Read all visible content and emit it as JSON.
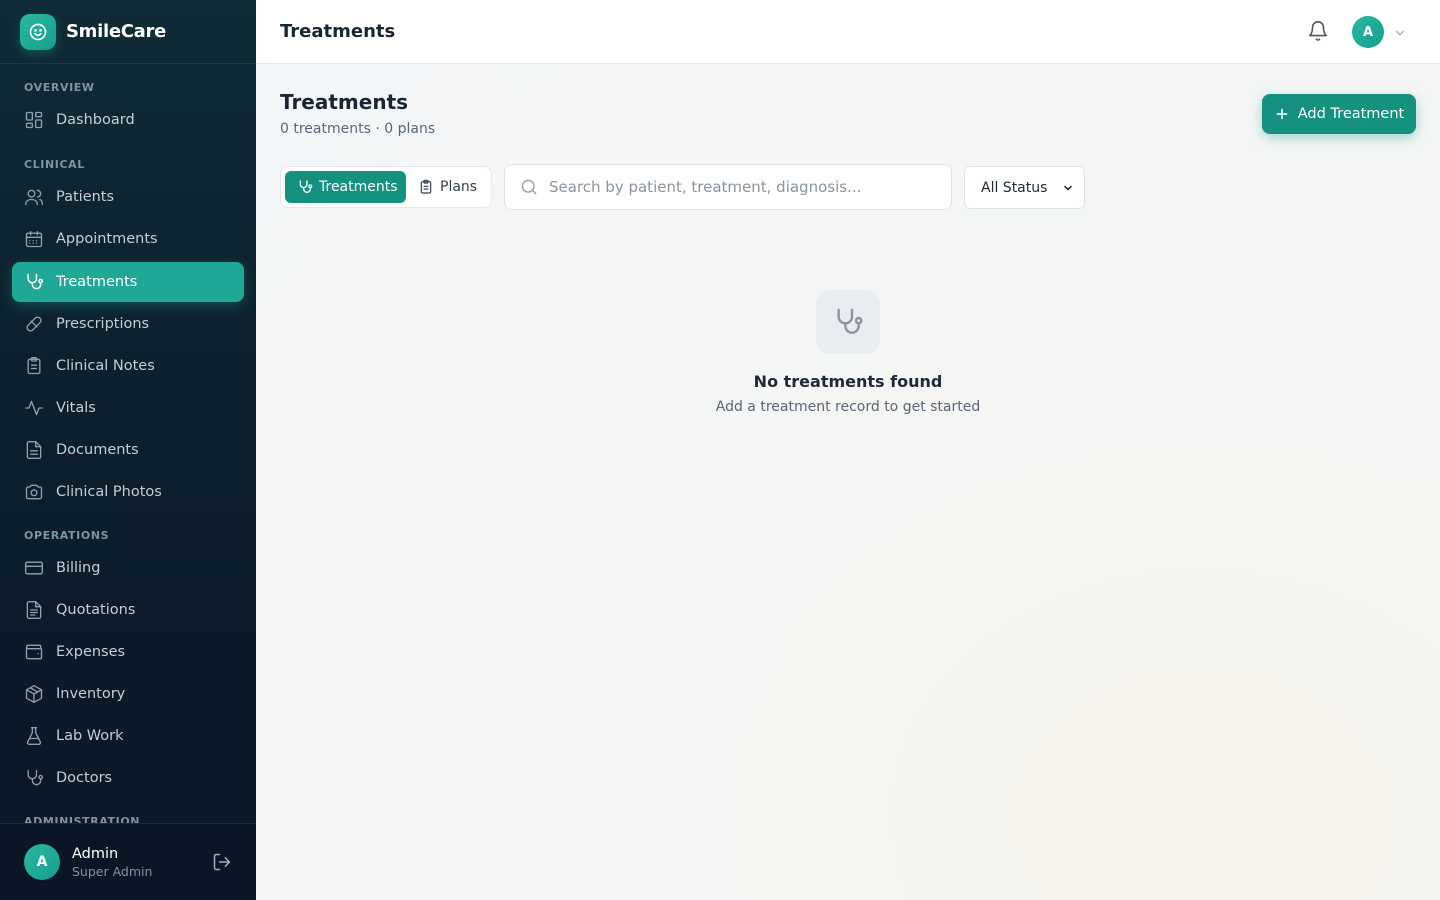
{
  "app": {
    "name": "SmileCare",
    "logo_icon": "smile-icon"
  },
  "sidebar": {
    "sections": [
      {
        "label": "OVERVIEW",
        "items": [
          {
            "label": "Dashboard",
            "icon": "dashboard-icon"
          }
        ]
      },
      {
        "label": "CLINICAL",
        "items": [
          {
            "label": "Patients",
            "icon": "users-icon"
          },
          {
            "label": "Appointments",
            "icon": "calendar-icon"
          },
          {
            "label": "Treatments",
            "icon": "stethoscope-icon",
            "active": true
          },
          {
            "label": "Prescriptions",
            "icon": "pill-icon"
          },
          {
            "label": "Clinical Notes",
            "icon": "clipboard-icon"
          },
          {
            "label": "Vitals",
            "icon": "activity-icon"
          },
          {
            "label": "Documents",
            "icon": "document-icon"
          },
          {
            "label": "Clinical Photos",
            "icon": "camera-icon"
          }
        ]
      },
      {
        "label": "OPERATIONS",
        "items": [
          {
            "label": "Billing",
            "icon": "credit-card-icon"
          },
          {
            "label": "Quotations",
            "icon": "file-text-icon"
          },
          {
            "label": "Expenses",
            "icon": "wallet-icon"
          },
          {
            "label": "Inventory",
            "icon": "box-icon"
          },
          {
            "label": "Lab Work",
            "icon": "flask-icon"
          },
          {
            "label": "Doctors",
            "icon": "stethoscope-icon"
          }
        ]
      },
      {
        "label": "ADMINISTRATION",
        "items": []
      }
    ]
  },
  "user": {
    "initial": "A",
    "name": "Admin",
    "role": "Super Admin"
  },
  "topbar": {
    "title": "Treatments",
    "avatar_initial": "A"
  },
  "page": {
    "title": "Treatments",
    "subtitle": "0 treatments · 0 plans",
    "add_button": "Add Treatment",
    "tabs": [
      {
        "label": "Treatments",
        "active": true
      },
      {
        "label": "Plans",
        "active": false
      }
    ],
    "search_placeholder": "Search by patient, treatment, diagnosis...",
    "status_filter": {
      "selected": "All Status"
    },
    "empty": {
      "title": "No treatments found",
      "subtitle": "Add a treatment record to get started"
    }
  },
  "colors": {
    "accent": "#14917f",
    "active_nav": "#1fa895",
    "sidebar_bg": "#0c1f2d"
  }
}
